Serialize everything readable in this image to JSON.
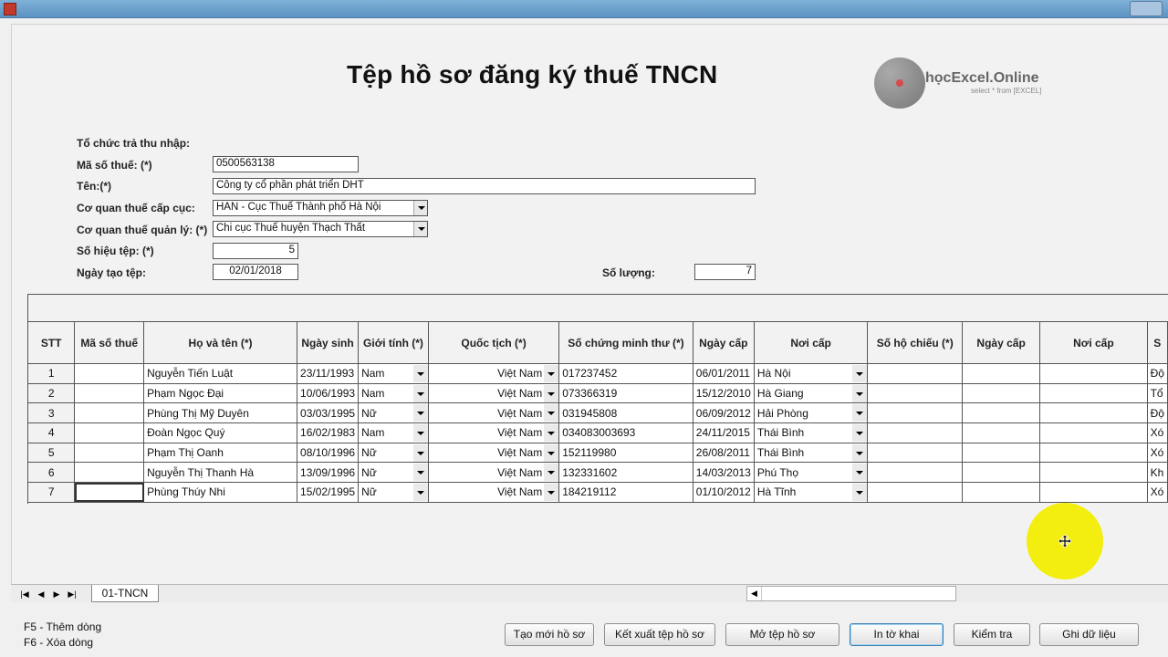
{
  "page": {
    "title": "Tệp hồ sơ đăng ký thuế TNCN"
  },
  "logo": {
    "name": "họcExcel.Online",
    "tagline": "select * from [EXCEL]"
  },
  "form": {
    "org_label": "Tổ chức trả thu nhập:",
    "tax_code_label": "Mã số thuế: (*)",
    "tax_code_value": "0500563138",
    "name_label": "Tên:(*)",
    "name_value": "Công ty cổ phần phát triển DHT",
    "dept_label": "Cơ quan thuế cấp cục:",
    "dept_value": "HAN - Cục Thuế Thành phố Hà Nội",
    "mgr_label": "Cơ quan thuế quản lý: (*)",
    "mgr_value": "Chi cục Thuế huyện Thạch Thất",
    "file_no_label": "Số hiệu tệp: (*)",
    "file_no_value": "5",
    "created_label": "Ngày tạo tệp:",
    "created_value": "02/01/2018",
    "count_label": "Số lượng:",
    "count_value": "7"
  },
  "grid": {
    "headers": [
      "STT",
      "Mã số thuế",
      "Họ và tên (*)",
      "Ngày sinh",
      "Giới tính (*)",
      "Quốc tịch (*)",
      "Số chứng minh thư (*)",
      "Ngày cấp",
      "Nơi cấp",
      "Số hộ chiếu (*)",
      "Ngày cấp",
      "Nơi cấp",
      "S"
    ],
    "rows": [
      {
        "stt": "1",
        "mst": "",
        "name": "Nguyễn Tiến Luật",
        "dob": "23/11/1993",
        "gender": "Nam",
        "nationality": "Việt Nam",
        "id_no": "017237452",
        "issue_date": "06/01/2011",
        "issue_place": "Hà Nội",
        "passport": "",
        "pp_date": "",
        "pp_place": "",
        "extra": "Độ"
      },
      {
        "stt": "2",
        "mst": "",
        "name": "Phạm Ngọc Đại",
        "dob": "10/06/1993",
        "gender": "Nam",
        "nationality": "Việt Nam",
        "id_no": "073366319",
        "issue_date": "15/12/2010",
        "issue_place": "Hà Giang",
        "passport": "",
        "pp_date": "",
        "pp_place": "",
        "extra": "Tổ"
      },
      {
        "stt": "3",
        "mst": "",
        "name": "Phùng Thị Mỹ Duyên",
        "dob": "03/03/1995",
        "gender": "Nữ",
        "nationality": "Việt Nam",
        "id_no": "031945808",
        "issue_date": "06/09/2012",
        "issue_place": "Hải Phòng",
        "passport": "",
        "pp_date": "",
        "pp_place": "",
        "extra": "Độ"
      },
      {
        "stt": "4",
        "mst": "",
        "name": "Đoàn Ngọc Quý",
        "dob": "16/02/1983",
        "gender": "Nam",
        "nationality": "Việt Nam",
        "id_no": "034083003693",
        "issue_date": "24/11/2015",
        "issue_place": "Thái Bình",
        "passport": "",
        "pp_date": "",
        "pp_place": "",
        "extra": "Xó"
      },
      {
        "stt": "5",
        "mst": "",
        "name": "Phạm Thị Oanh",
        "dob": "08/10/1996",
        "gender": "Nữ",
        "nationality": "Việt Nam",
        "id_no": "152119980",
        "issue_date": "26/08/2011",
        "issue_place": "Thái Bình",
        "passport": "",
        "pp_date": "",
        "pp_place": "",
        "extra": "Xó"
      },
      {
        "stt": "6",
        "mst": "",
        "name": "Nguyễn Thị Thanh Hà",
        "dob": "13/09/1996",
        "gender": "Nữ",
        "nationality": "Việt Nam",
        "id_no": "132331602",
        "issue_date": "14/03/2013",
        "issue_place": "Phú Thọ",
        "passport": "",
        "pp_date": "",
        "pp_place": "",
        "extra": "Kh"
      },
      {
        "stt": "7",
        "mst": "",
        "name": "Phùng Thúy Nhi",
        "dob": "15/02/1995",
        "gender": "Nữ",
        "nationality": "Việt Nam",
        "id_no": "184219112",
        "issue_date": "01/10/2012",
        "issue_place": "Hà Tĩnh",
        "passport": "",
        "pp_date": "",
        "pp_place": "",
        "extra": "Xó"
      }
    ]
  },
  "sheet_tabs": {
    "active": "01-TNCN"
  },
  "help": {
    "line1": "F5 - Thêm dòng",
    "line2": "F6 - Xóa dòng"
  },
  "buttons": {
    "new": "Tạo mới hồ sơ",
    "export": "Kết xuất tệp hồ sơ",
    "open": "Mở tệp hồ sơ",
    "print": "In tờ khai",
    "check": "Kiểm tra",
    "save": "Ghi dữ liệu"
  }
}
